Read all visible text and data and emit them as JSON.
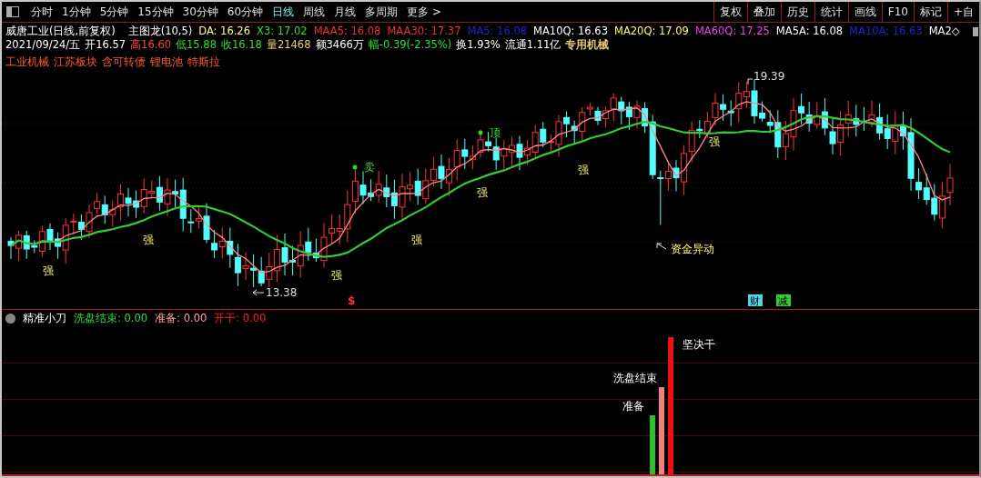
{
  "toolbar": {
    "periods": [
      {
        "label": "分时",
        "selected": false
      },
      {
        "label": "1分钟",
        "selected": false
      },
      {
        "label": "5分钟",
        "selected": false
      },
      {
        "label": "15分钟",
        "selected": false
      },
      {
        "label": "30分钟",
        "selected": false
      },
      {
        "label": "60分钟",
        "selected": false
      },
      {
        "label": "日线",
        "selected": true
      },
      {
        "label": "周线",
        "selected": false
      },
      {
        "label": "月线",
        "selected": false
      },
      {
        "label": "多周期",
        "selected": false
      },
      {
        "label": "更多 >",
        "selected": false
      }
    ],
    "tools": [
      "复权",
      "叠加",
      "历史",
      "统计",
      "画线",
      "F10",
      "标记",
      "+自"
    ]
  },
  "header": {
    "title": "威唐工业(日线,前复权)",
    "indicator": "主图龙(10,5)",
    "readings": [
      {
        "text": "DA: 16.26",
        "color": "#ffff80"
      },
      {
        "text": "X3: 17.02",
        "color": "#33dd33"
      },
      {
        "text": "MAA5: 16.08",
        "color": "#ee3333"
      },
      {
        "text": "MAA30: 17.37",
        "color": "#ee3333"
      },
      {
        "text": "MA5: 16.08",
        "color": "#2222cc"
      },
      {
        "text": "MA10Q: 16.63",
        "color": "#ffffff"
      },
      {
        "text": "MA20Q: 17.09",
        "color": "#ffff60"
      },
      {
        "text": "MA60Q: 17.25",
        "color": "#ee44ee"
      },
      {
        "text": "MA5A: 16.08",
        "color": "#ffffff"
      },
      {
        "text": "MA10A: 16.63",
        "color": "#2222cc"
      },
      {
        "text": "MA2◇",
        "color": "#ffffff"
      }
    ],
    "quote": [
      {
        "text": "2021/09/24/五",
        "color": "#ffffff"
      },
      {
        "text": "开16.57",
        "color": "#ffffff"
      },
      {
        "text": "高16.60",
        "color": "#ff4040"
      },
      {
        "text": "低15.88",
        "color": "#33dd33"
      },
      {
        "text": "收16.18",
        "color": "#33dd33"
      },
      {
        "text": "量21468",
        "color": "#e8d070"
      },
      {
        "text": "额3466万",
        "color": "#ffffff"
      },
      {
        "text": "幅-0.39(-2.35%)",
        "color": "#33dd33"
      },
      {
        "text": "换1.93%",
        "color": "#ffffff"
      },
      {
        "text": "流通1.11亿",
        "color": "#ffffff"
      },
      {
        "text": "专用机械",
        "color": "#e8d070"
      }
    ],
    "tags": [
      "工业机械",
      "江苏板块",
      "含可转债",
      "锂电池",
      "特斯拉"
    ]
  },
  "chart": {
    "annotations": [
      {
        "kind": "strong",
        "text": "强"
      },
      {
        "kind": "strong",
        "text": "强"
      },
      {
        "kind": "strong",
        "text": "强"
      },
      {
        "kind": "strong",
        "text": "强"
      },
      {
        "kind": "strong",
        "text": "强"
      },
      {
        "kind": "strong",
        "text": "强"
      },
      {
        "kind": "strong",
        "text": "强"
      },
      {
        "kind": "signal",
        "text": "卖"
      },
      {
        "kind": "signal",
        "text": "顶"
      },
      {
        "kind": "pointer",
        "text": "资金异动"
      },
      {
        "kind": "pointer",
        "text": "19.39"
      },
      {
        "kind": "pointer",
        "text": "13.38"
      },
      {
        "kind": "mark",
        "text": "$"
      },
      {
        "kind": "badge",
        "text": "财",
        "color": "#4fd6e6"
      },
      {
        "kind": "badge",
        "text": "减",
        "color": "#33cc33"
      }
    ]
  },
  "panel": {
    "title": "精准小刀",
    "readings": [
      {
        "text": "洗盘结束: 0.00",
        "color": "#33dd33"
      },
      {
        "text": "准备: 0.00",
        "color": "#ffa0a0"
      },
      {
        "text": "开干: 0.00",
        "color": "#ff2020"
      }
    ],
    "bars": [
      {
        "label": "准备",
        "color": "#33bb33"
      },
      {
        "label": "洗盘结束",
        "color": "#f08080"
      },
      {
        "label": "坚决干",
        "color": "#ee1111"
      }
    ]
  }
}
